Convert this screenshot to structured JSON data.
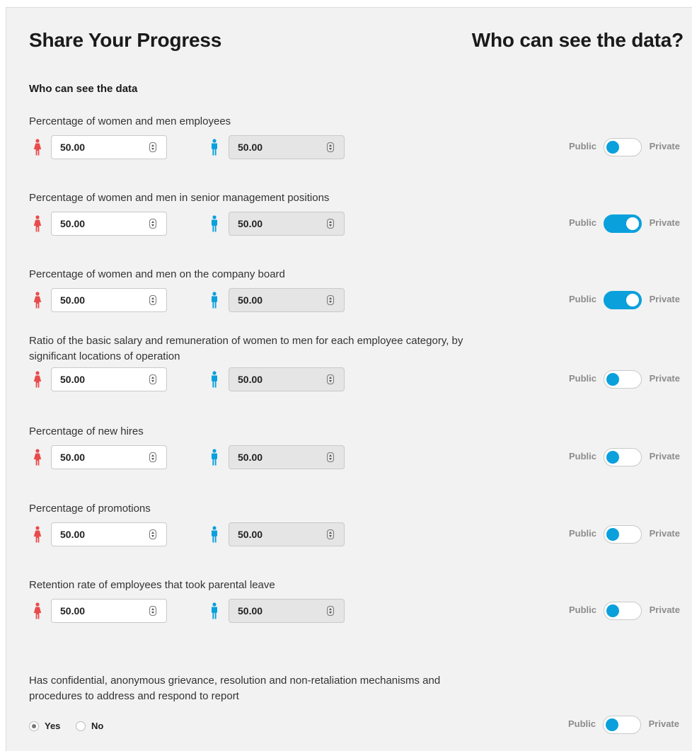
{
  "header": {
    "title": "Share Your Progress",
    "right_title": "Who can see the data?"
  },
  "section": {
    "subtitle": "Who can see the data"
  },
  "colors": {
    "female": "#e94b4b",
    "male": "#0aa0dc",
    "toggle": "#0aa0dc"
  },
  "icons": {
    "female": "woman-icon",
    "male": "man-icon",
    "spinner": "spinner-arrows-icon"
  },
  "toggle": {
    "public_label": "Public",
    "private_label": "Private"
  },
  "questions": [
    {
      "label": "Percentage of women and men employees",
      "female_value": "50.00",
      "male_value": "50.00",
      "private": false
    },
    {
      "label": "Percentage of women and men in senior management positions",
      "female_value": "50.00",
      "male_value": "50.00",
      "private": true
    },
    {
      "label": "Percentage of women and men on the company board",
      "female_value": "50.00",
      "male_value": "50.00",
      "private": true
    },
    {
      "label": "Ratio of the basic salary and remuneration of women to men for each employee category, by significant locations of operation",
      "female_value": "50.00",
      "male_value": "50.00",
      "private": false
    },
    {
      "label": "Percentage of new hires",
      "female_value": "50.00",
      "male_value": "50.00",
      "private": false
    },
    {
      "label": "Percentage of promotions",
      "female_value": "50.00",
      "male_value": "50.00",
      "private": false
    },
    {
      "label": "Retention rate of employees that took parental leave",
      "female_value": "50.00",
      "male_value": "50.00",
      "private": false
    }
  ],
  "grievance": {
    "label": "Has confidential, anonymous grievance, resolution and non-retaliation mechanisms and procedures to address and respond to report",
    "options": [
      {
        "label": "Yes",
        "checked": true
      },
      {
        "label": "No",
        "checked": false
      }
    ],
    "private": false
  }
}
